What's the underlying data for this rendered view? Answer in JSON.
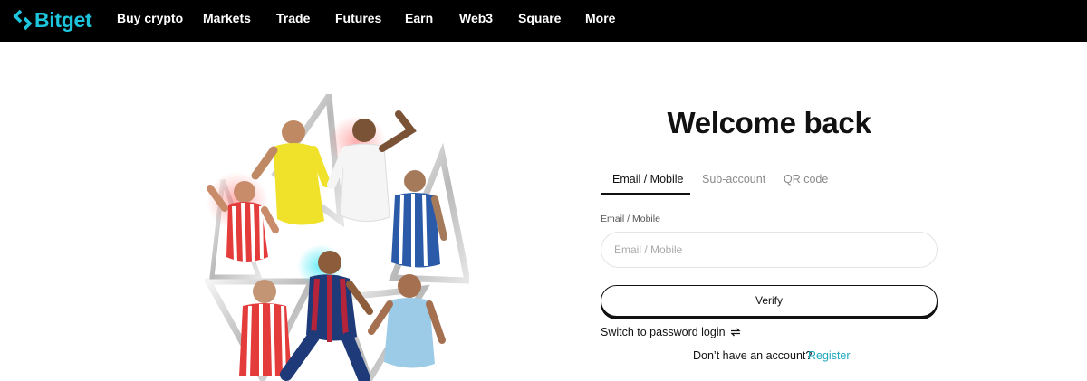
{
  "brand": {
    "name": "Bitget",
    "accent_color": "#1dc5dc",
    "icon": "bitget-logo-icon"
  },
  "nav": {
    "items": [
      {
        "label": "Buy crypto"
      },
      {
        "label": "Markets"
      },
      {
        "label": "Trade"
      },
      {
        "label": "Futures"
      },
      {
        "label": "Earn"
      },
      {
        "label": "Web3"
      },
      {
        "label": "Square"
      },
      {
        "label": "More"
      }
    ]
  },
  "hero": {
    "image": "football-players-promo-image"
  },
  "login": {
    "title": "Welcome back",
    "tabs": [
      {
        "label": "Email / Mobile",
        "active": true
      },
      {
        "label": "Sub-account",
        "active": false
      },
      {
        "label": "QR code",
        "active": false
      }
    ],
    "field_label": "Email / Mobile",
    "input_placeholder": "Email / Mobile",
    "input_value": "",
    "verify_label": "Verify",
    "switch_label": "Switch to password login",
    "switch_icon": "swap-arrows-icon",
    "signup_text": "Don’t have an account?",
    "register_label": "Register",
    "register_color": "#1fa7bd"
  }
}
